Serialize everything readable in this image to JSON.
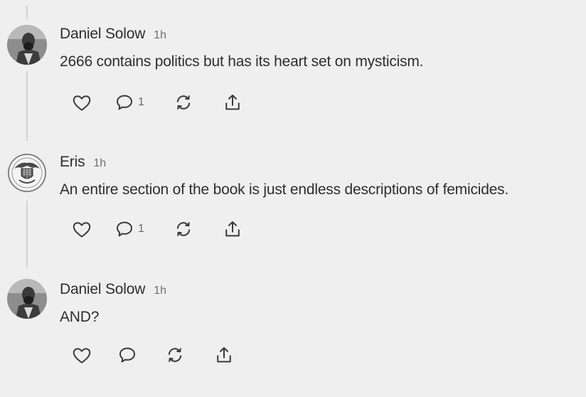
{
  "comments": [
    {
      "author": "Daniel Solow",
      "time": "1h",
      "text": "2666 contains politics but has its heart set on mysticism.",
      "avatar_icon": "profile-photo-icon",
      "reply_count": "1",
      "actions": [
        "like-icon",
        "reply-icon",
        "restack-icon",
        "share-icon"
      ]
    },
    {
      "author": "Eris",
      "time": "1h",
      "text": "An entire section of the book is just endless descriptions of femicides.",
      "avatar_icon": "seal-emblem-icon",
      "reply_count": "1",
      "actions": [
        "like-icon",
        "reply-icon",
        "restack-icon",
        "share-icon"
      ]
    },
    {
      "author": "Daniel Solow",
      "time": "1h",
      "text": "AND?",
      "avatar_icon": "profile-photo-icon",
      "reply_count": "",
      "actions": [
        "like-icon",
        "reply-icon",
        "restack-icon",
        "share-icon"
      ]
    }
  ],
  "colors": {
    "background": "#efefef",
    "text": "#2e2e2e",
    "muted": "#6f6f6f",
    "icon": "#3a3a3a",
    "thread_line": "#d2d2d2"
  }
}
